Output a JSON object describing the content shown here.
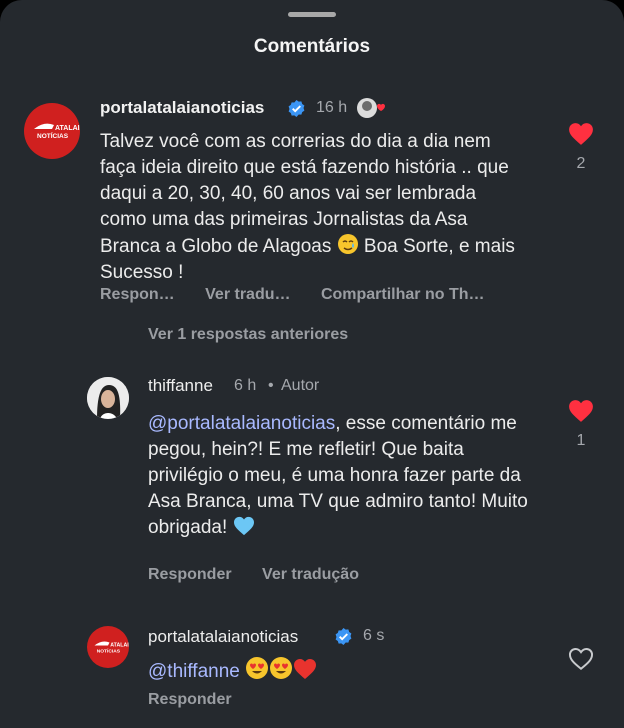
{
  "sheet": {
    "title": "Comentários"
  },
  "comment1": {
    "avatar_text": "ATALAIA NOTÍCIAS",
    "username": "portalatalaianoticias",
    "time": "16 h",
    "text_main": "Talvez você com as correrias do dia a dia nem faça ideia direito que está fazendo história .. que daqui a 20, 30, 40, 60 anos vai ser lembrada como uma das primeiras Jornalistas da Asa Branca a Globo de Alagoas",
    "text_end": "Boa Sorte, e mais Sucesso !",
    "action_reply": "Respon…",
    "action_translate": "Ver tradu…",
    "action_share": "Compartilhar no Th…",
    "likes": "2",
    "view_previous": "Ver 1 respostas anteriores"
  },
  "comment2": {
    "username": "thiffanne",
    "time": "6 h",
    "dot": "•",
    "badge": "Autor",
    "mention": "@portalatalaianoticias",
    "text": ", esse comentário me pegou, hein?! E me refletir! Que baita privilégio o meu, é uma honra fazer parte da Asa Branca, uma TV que admiro tanto! Muito obrigada!",
    "action_reply": "Responder",
    "action_translate": "Ver tradução",
    "likes": "1"
  },
  "comment3": {
    "avatar_text": "ATALAIA NOTÍCIAS",
    "username": "portalatalaianoticias",
    "time": "6 s",
    "mention": "@thiffanne",
    "action_reply": "Responder"
  },
  "colors": {
    "like_red": "#ff3040",
    "verified_blue": "#3b95f4",
    "logo_red": "#d0201f",
    "background": "#25292e"
  }
}
